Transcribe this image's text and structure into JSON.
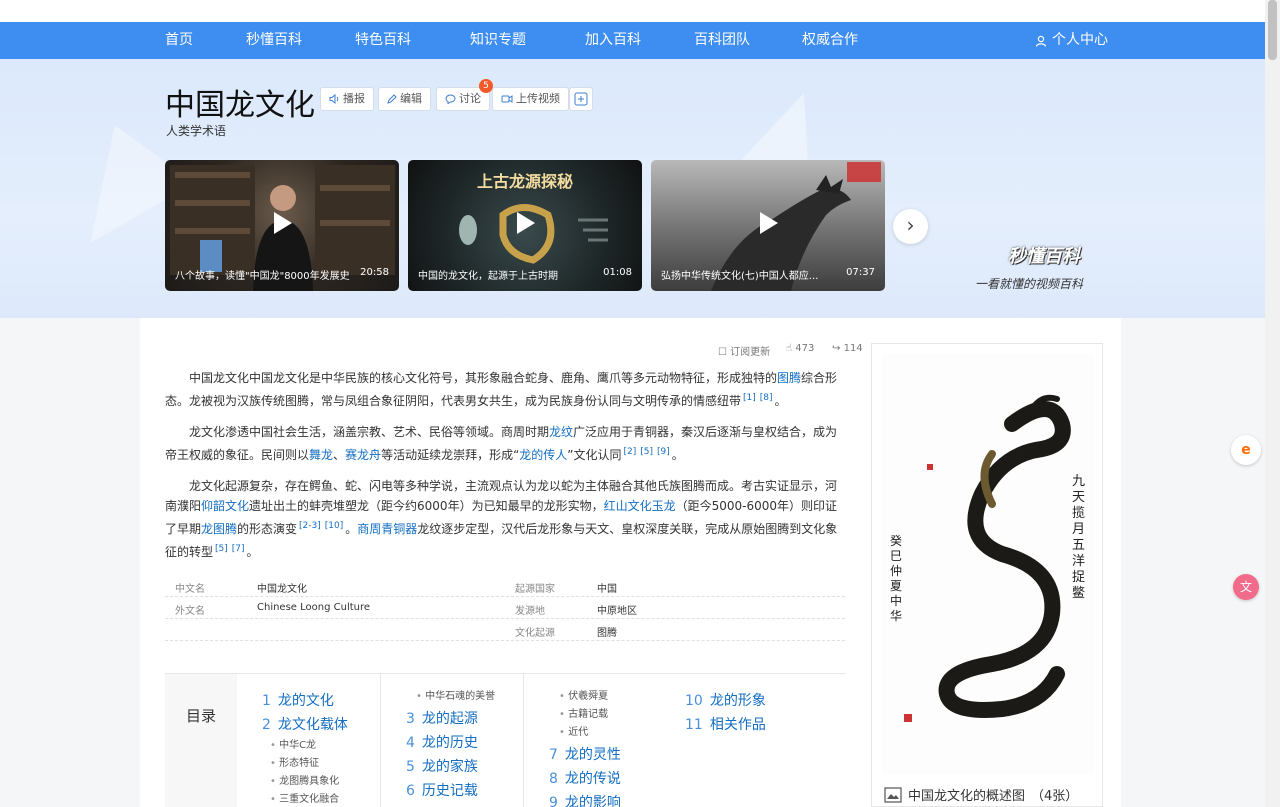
{
  "nav": {
    "items": [
      "首页",
      "秒懂百科",
      "特色百科",
      "知识专题",
      "加入百科",
      "百科团队",
      "权威合作"
    ],
    "user": "个人中心"
  },
  "header": {
    "title": "中国龙文化",
    "subtitle": "人类学术语",
    "buttons": {
      "broadcast": "播报",
      "edit": "编辑",
      "discuss": "讨论",
      "upload_video": "上传视频"
    },
    "discuss_badge": "5"
  },
  "videos": [
    {
      "caption": "八个故事，读懂\"中国龙\"8000年发展史",
      "duration": "20:58"
    },
    {
      "caption": "中国的龙文化，起源于上古时期",
      "duration": "01:08",
      "banner": "上古龙源探秘"
    },
    {
      "caption": "弘扬中华传统文化(七)中国人都应...",
      "duration": "07:37"
    }
  ],
  "brand": {
    "name": "秒懂百科",
    "slogan": "一看就懂的视频百科"
  },
  "meta": {
    "subscribe": "订阅更新",
    "likes": "473",
    "shares": "114"
  },
  "paragraphs": {
    "p1": {
      "t1": "中国龙文化中国龙文化是中华民族的核心文化符号，其形象融合蛇身、鹿角、鹰爪等多元动物特征，形成独特的",
      "l1": "图腾",
      "t2": "综合形态。龙被视为汉族传统图腾，常与凤组合象征阴阳，代表男女共生，成为民族身份认同与文明传承的情感纽带",
      "r1": "[1]",
      "r2": "[8]",
      "end": "。"
    },
    "p2": {
      "t1": "龙文化渗透中国社会生活，涵盖宗教、艺术、民俗等领域。商周时期",
      "l1": "龙纹",
      "t2": "广泛应用于青铜器，秦汉后逐渐与皇权结合，成为帝王权威的象征。民间则以",
      "l2": "舞龙",
      "sep": "、",
      "l3": "赛龙舟",
      "t3": "等活动延续龙崇拜，形成“",
      "l4": "龙的传人",
      "t4": "”文化认同",
      "r1": "[2]",
      "r2": "[5]",
      "r3": "[9]",
      "end": "。"
    },
    "p3": {
      "t1": "龙文化起源复杂，存在鳄鱼、蛇、闪电等多种学说，主流观点认为龙以蛇为主体融合其他氏族图腾而成。考古实证显示，河南濮阳",
      "l1": "仰韶文化",
      "t2": "遗址出土的蚌壳堆塑龙（距今约6000年）为已知最早的龙形实物，",
      "l2": "红山文化玉龙",
      "t3": "（距今5000-6000年）则印证了早期",
      "l3": "龙图腾",
      "t4": "的形态演变",
      "r1": "[2-3]",
      "r2": "[10]",
      "t5": "。",
      "l4": "商周青铜器",
      "t6": "龙纹逐步定型，汉代后龙形象与天文、皇权深度关联，完成从原始图腾到文化象征的转型",
      "r3": "[5]",
      "r4": "[7]",
      "end": "。"
    }
  },
  "basic_info": {
    "row1": {
      "k1": "中文名",
      "v1": "中国龙文化",
      "k2": "起源国家",
      "v2": "中国"
    },
    "row2": {
      "k1": "外文名",
      "v1": "Chinese Loong Culture",
      "k2": "发源地",
      "v2": "中原地区"
    },
    "row3": {
      "k2": "文化起源",
      "v2": "图腾"
    }
  },
  "toc": {
    "label": "目录",
    "col1": [
      {
        "n": "1",
        "t": "龙的文化"
      },
      {
        "n": "2",
        "t": "龙文化载体"
      }
    ],
    "col1_subs": [
      "中华C龙",
      "形态特征",
      "龙图腾具象化",
      "三重文化融合"
    ],
    "col2_subs": [
      "中华石魂的美誉"
    ],
    "col2": [
      {
        "n": "3",
        "t": "龙的起源"
      },
      {
        "n": "4",
        "t": "龙的历史"
      },
      {
        "n": "5",
        "t": "龙的家族"
      },
      {
        "n": "6",
        "t": "历史记载"
      }
    ],
    "col3_subs": [
      "伏羲舜夏",
      "古籍记载",
      "近代"
    ],
    "col3": [
      {
        "n": "7",
        "t": "龙的灵性"
      },
      {
        "n": "8",
        "t": "龙的传说"
      },
      {
        "n": "9",
        "t": "龙的影响"
      }
    ],
    "col4": [
      {
        "n": "10",
        "t": "龙的形象"
      },
      {
        "n": "11",
        "t": "相关作品"
      }
    ]
  },
  "side": {
    "caption": "中国龙文化的概述图",
    "count": "（4张）",
    "calligraphy_left": "癸巳仲夏 中华",
    "calligraphy_right": "九天揽月 五洋捉鳖"
  }
}
